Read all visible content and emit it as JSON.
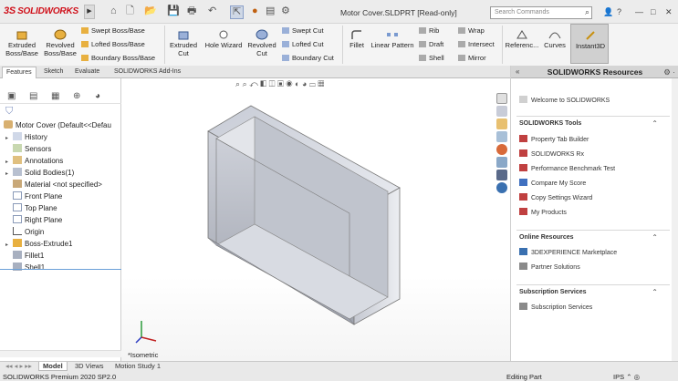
{
  "titlebar": {
    "logo_prefix": "3S",
    "logo_text": "SOLIDWORKS",
    "doc_title": "Motor Cover.SLDPRT [Read-only]",
    "search_placeholder": "Search Commands",
    "help": "?",
    "minimize": "—",
    "maximize": "□",
    "close": "✕"
  },
  "ribbon": {
    "extruded_boss": "Extruded Boss/Base",
    "revolved_boss": "Revolved Boss/Base",
    "swept_boss": "Swept Boss/Base",
    "lofted_boss": "Lofted Boss/Base",
    "boundary_boss": "Boundary Boss/Base",
    "extruded_cut": "Extruded Cut",
    "hole_wizard": "Hole Wizard",
    "revolved_cut": "Revolved Cut",
    "swept_cut": "Swept Cut",
    "lofted_cut": "Lofted Cut",
    "boundary_cut": "Boundary Cut",
    "fillet": "Fillet",
    "linear_pattern": "Linear Pattern",
    "rib": "Rib",
    "draft": "Draft",
    "shell": "Shell",
    "wrap": "Wrap",
    "intersect": "Intersect",
    "mirror": "Mirror",
    "reference": "Referenc...",
    "curves": "Curves",
    "instant3d": "Instant3D"
  },
  "tabs": [
    "Features",
    "Sketch",
    "Evaluate",
    "SOLIDWORKS Add-Ins"
  ],
  "tree": {
    "root": "Motor Cover  (Default<<Defau",
    "items": [
      "History",
      "Sensors",
      "Annotations",
      "Solid Bodies(1)",
      "Material <not specified>",
      "Front Plane",
      "Top Plane",
      "Right Plane",
      "Origin",
      "Boss-Extrude1",
      "Fillet1",
      "Shell1"
    ]
  },
  "viewport": {
    "view_label": "*Isometric"
  },
  "resources": {
    "title": "SOLIDWORKS Resources",
    "welcome": "Welcome to SOLIDWORKS",
    "tools_title": "SOLIDWORKS Tools",
    "tools": [
      "Property Tab Builder",
      "SOLIDWORKS Rx",
      "Performance Benchmark Test",
      "Compare My Score",
      "Copy Settings Wizard",
      "My Products"
    ],
    "online_title": "Online Resources",
    "online": [
      "3DEXPERIENCE Marketplace",
      "Partner Solutions"
    ],
    "subs_title": "Subscription Services",
    "subs": [
      "Subscription Services"
    ]
  },
  "bottom_tabs": [
    "Model",
    "3D Views",
    "Motion Study 1"
  ],
  "status": {
    "product": "SOLIDWORKS Premium 2020 SP2.0",
    "mode": "Editing Part",
    "units": "IPS"
  },
  "colors": {
    "brand": "#d0101a",
    "accent": "#6aa0d8"
  }
}
